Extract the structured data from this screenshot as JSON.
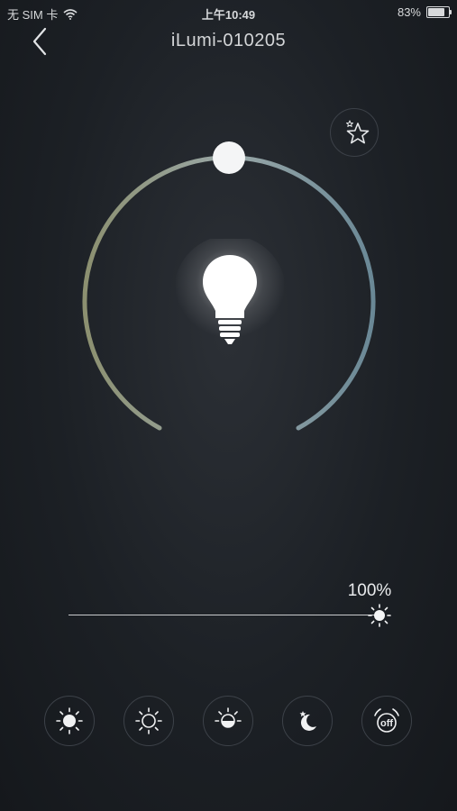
{
  "status_bar": {
    "carrier": "无 SIM 卡",
    "time": "上午10:49",
    "battery_text": "83%",
    "battery_level": 0.83,
    "wifi_icon": "wifi-icon"
  },
  "header": {
    "title": "iLumi-010205",
    "back_icon": "chevron-left-icon"
  },
  "favorite": {
    "icon": "star-icon"
  },
  "color_dial": {
    "colors": {
      "warm": "#8c9070",
      "mid": "#9aa8a8",
      "cool": "#6a8896"
    }
  },
  "bulb": {
    "icon": "light-bulb-icon",
    "state": "on"
  },
  "brightness": {
    "label": "100%",
    "value": 100,
    "thumb_icon": "sun-icon"
  },
  "scenes": [
    {
      "name": "bright",
      "icon": "sun-full-icon"
    },
    {
      "name": "dim",
      "icon": "sun-outline-icon"
    },
    {
      "name": "half",
      "icon": "sun-half-icon"
    },
    {
      "name": "night",
      "icon": "moon-star-icon"
    },
    {
      "name": "off",
      "icon": "alarm-off-icon",
      "label": "off"
    }
  ]
}
